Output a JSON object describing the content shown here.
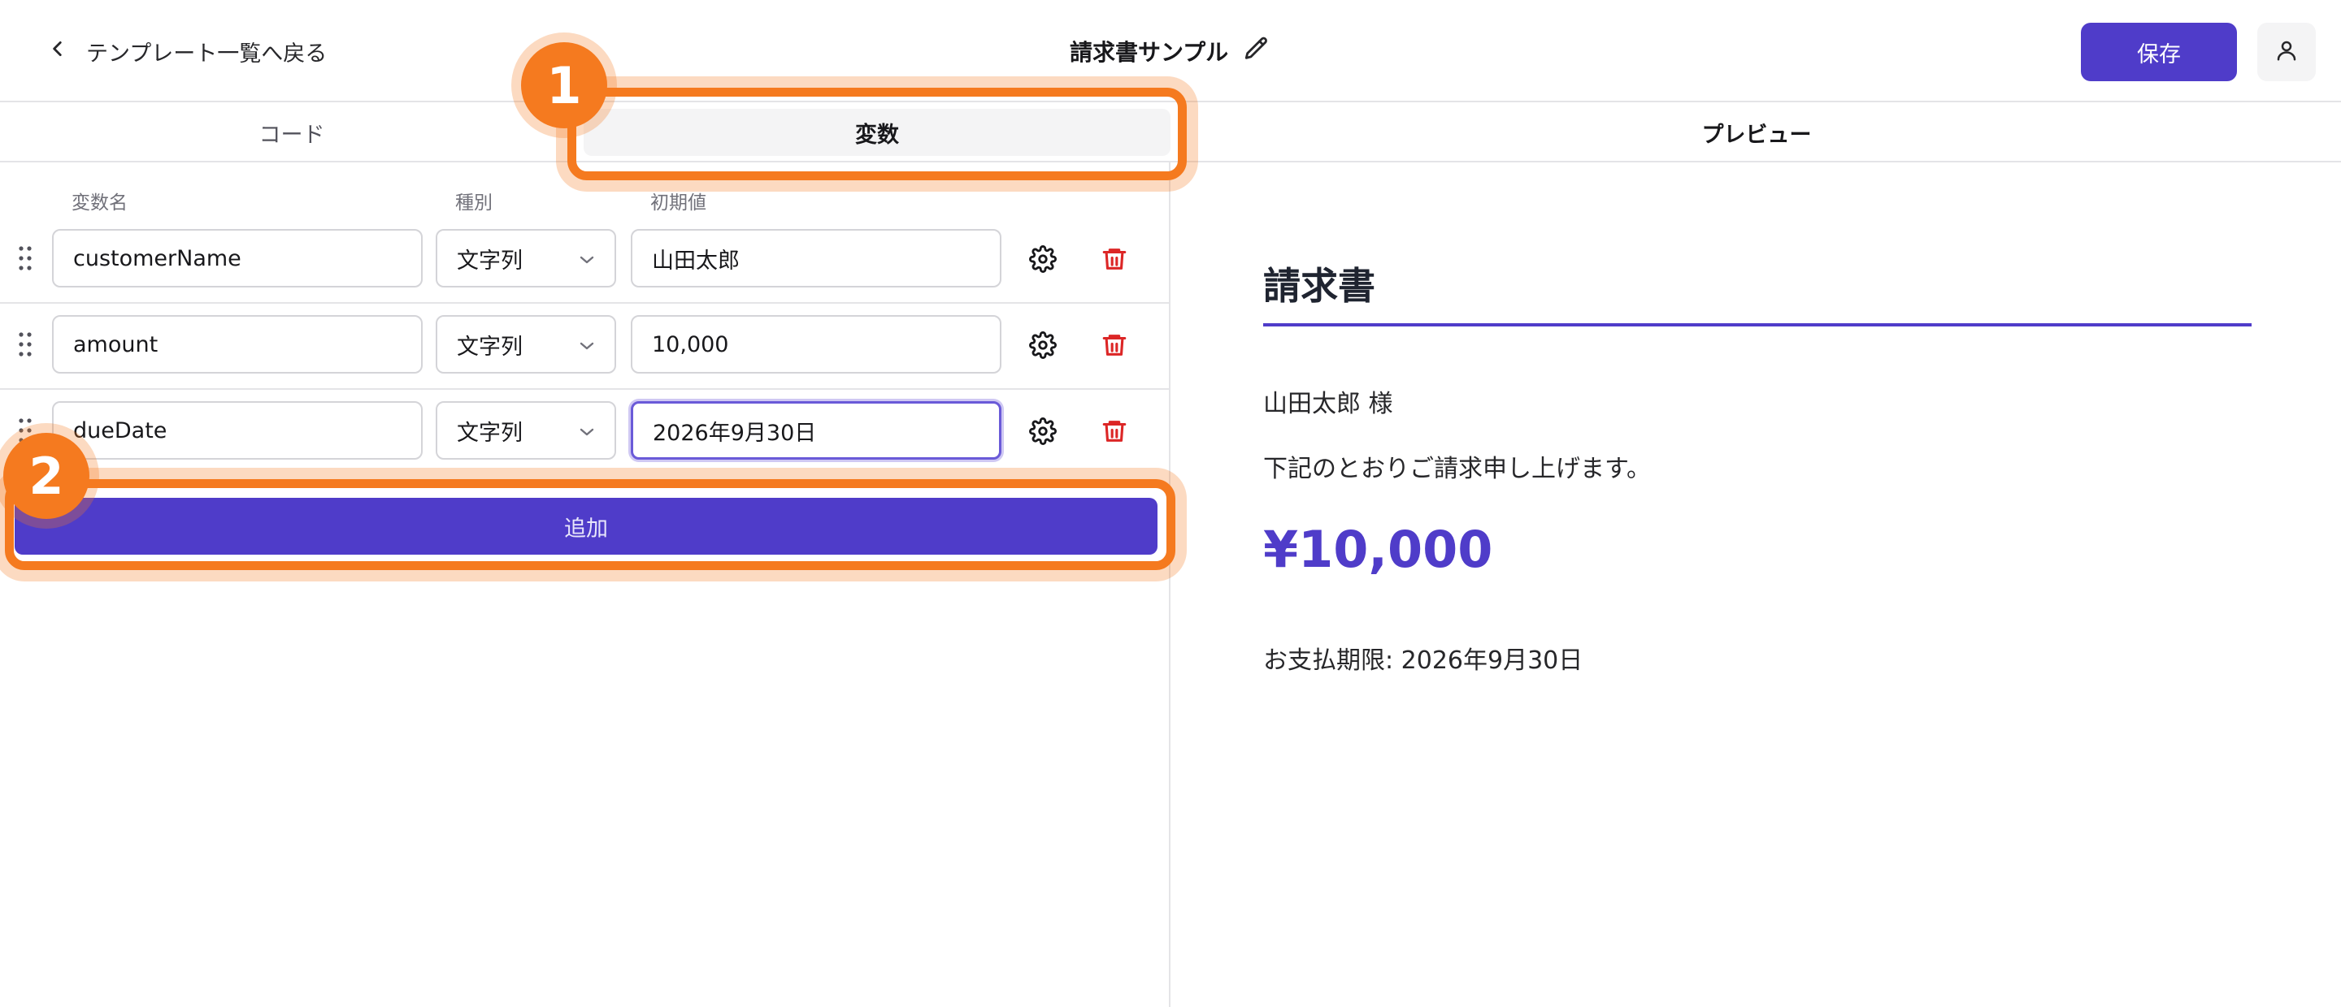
{
  "header": {
    "back_label": "テンプレート一覧へ戻る",
    "title": "請求書サンプル",
    "save_label": "保存"
  },
  "tabs": [
    {
      "label": "コード",
      "active": false
    },
    {
      "label": "変数",
      "active": true
    },
    {
      "label": "プレビュー",
      "active": false
    }
  ],
  "variables": {
    "columns": {
      "name": "変数名",
      "type": "種別",
      "initial": "初期値"
    },
    "rows": [
      {
        "name": "customerName",
        "type": "文字列",
        "initial": "山田太郎"
      },
      {
        "name": "amount",
        "type": "文字列",
        "initial": "10,000"
      },
      {
        "name": "dueDate",
        "type": "文字列",
        "initial": "2026年9月30日"
      }
    ],
    "add_label": "追加"
  },
  "preview": {
    "heading": "請求書",
    "customer_line": "山田太郎 様",
    "body_line": "下記のとおりご請求申し上げます。",
    "amount": "¥10,000",
    "due_line": "お支払期限: 2026年9月30日"
  },
  "annotations": {
    "step1": "1",
    "step2": "2",
    "highlight_color": "#f57a1f"
  },
  "colors": {
    "accent": "#4f3cc9",
    "danger": "#dc2626"
  },
  "icons": {
    "back": "chevron-left-icon",
    "edit": "pencil-icon",
    "user": "user-icon",
    "drag": "drag-handle-icon",
    "dropdown": "chevron-down-icon",
    "settings": "gear-icon",
    "delete": "trash-icon"
  }
}
